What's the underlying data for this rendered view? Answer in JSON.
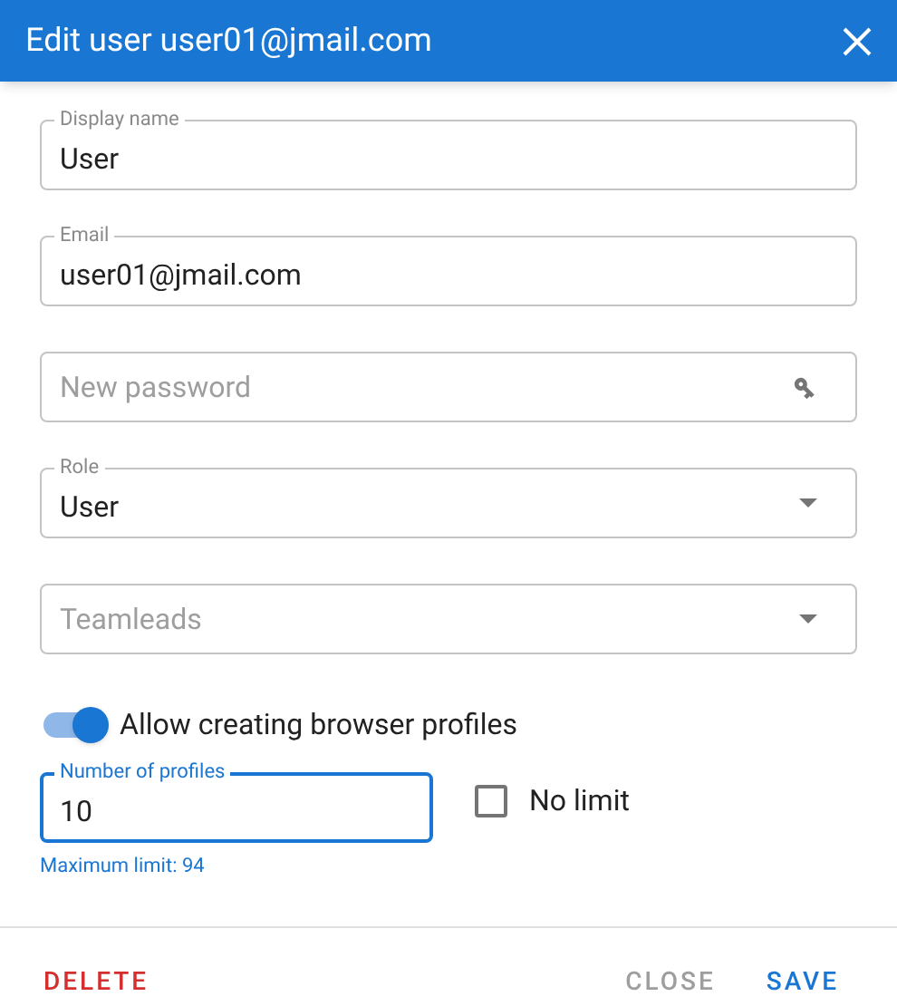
{
  "dialog": {
    "title": "Edit user user01@jmail.com"
  },
  "fields": [
    {
      "kind": "text",
      "label": "Display name",
      "value": "User"
    },
    {
      "kind": "text",
      "label": "Email",
      "value": "user01@jmail.com"
    },
    {
      "kind": "password",
      "placeholder": "New password"
    },
    {
      "kind": "select",
      "label": "Role",
      "value": "User"
    },
    {
      "kind": "select",
      "placeholder": "Teamleads"
    }
  ],
  "profiles_toggle": {
    "label": "Allow creating browser profiles",
    "on": true
  },
  "profiles_count": {
    "label": "Number of profiles",
    "value": "10",
    "focused": true,
    "helper": "Maximum limit: 94"
  },
  "no_limit": {
    "label": "No limit",
    "checked": false
  },
  "buttons": [
    {
      "kind": "danger",
      "label": "DELETE"
    },
    {
      "kind": "secondary",
      "label": "CLOSE"
    },
    {
      "kind": "primary",
      "label": "SAVE"
    }
  ]
}
